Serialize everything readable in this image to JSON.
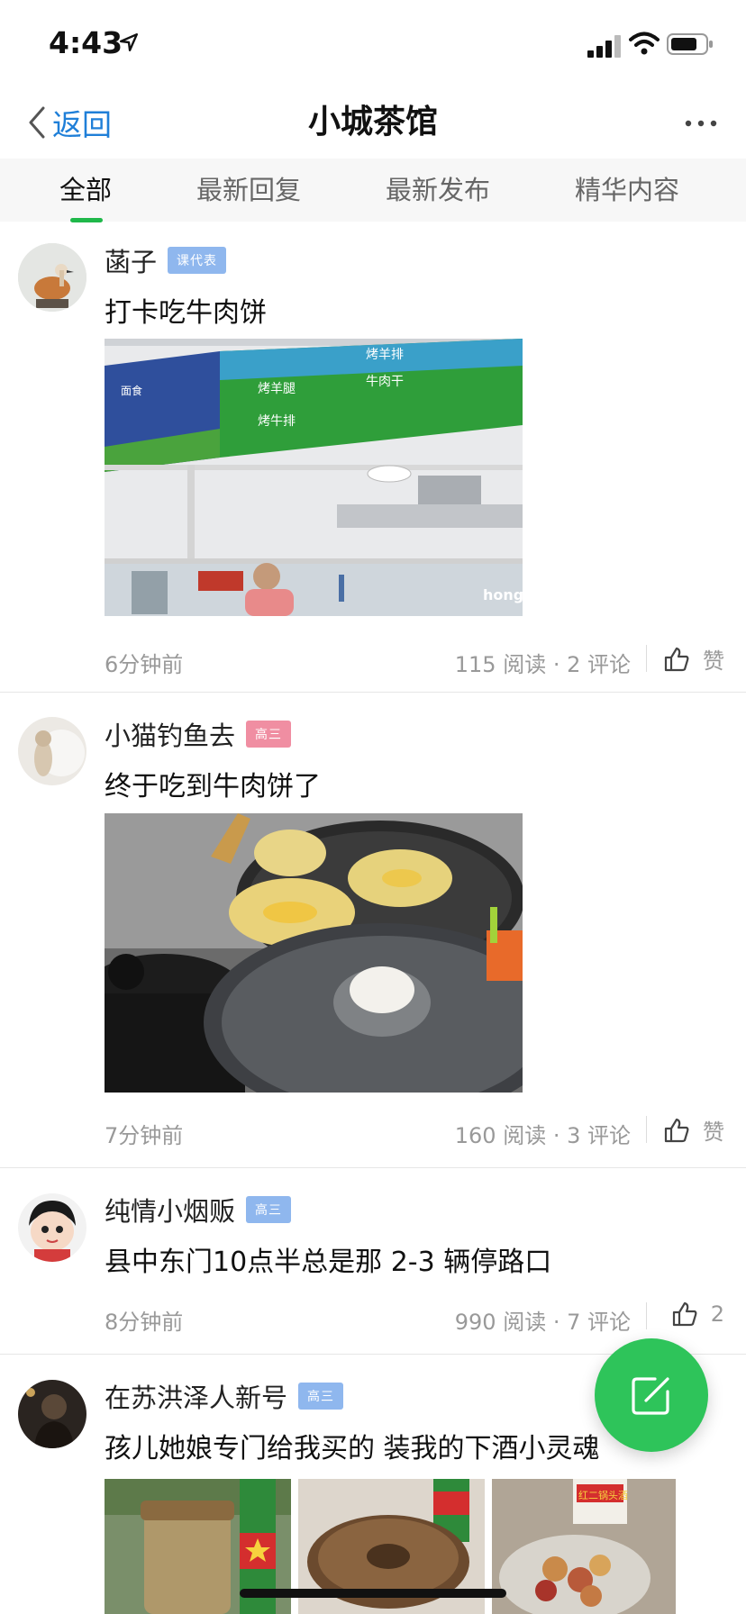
{
  "status_bar": {
    "time": "4:43"
  },
  "nav": {
    "back_label": "返回",
    "title": "小城茶馆"
  },
  "tabs": [
    {
      "label": "全部"
    },
    {
      "label": "最新回复"
    },
    {
      "label": "最新发布"
    },
    {
      "label": "精华内容"
    }
  ],
  "posts": [
    {
      "author": "菡子",
      "badge": "课代表",
      "text": "打卡吃牛肉饼",
      "time": "6分钟前",
      "stats": "115 阅读 · 2 评论",
      "like_label": "赞"
    },
    {
      "author": "小猫钓鱼去",
      "badge": "高三",
      "text": "终于吃到牛肉饼了",
      "time": "7分钟前",
      "stats": "160 阅读 · 3 评论",
      "like_label": "赞"
    },
    {
      "author": "纯情小烟贩",
      "badge": "高三",
      "text": "县中东门10点半总是那 2-3 辆停路口",
      "time": "8分钟前",
      "stats": "990 阅读 · 7 评论",
      "like_label": "2"
    },
    {
      "author": "在苏洪泽人新号",
      "badge": "高三",
      "text": "孩儿她娘专门给我买的 装我的下酒小灵魂"
    }
  ],
  "post1_image": {
    "sign_text_1": "烤羊排",
    "sign_text_2": "牛肉干",
    "sign_text_3": "烤羊腿",
    "sign_text_4": "烤牛排",
    "left_sign": "面食",
    "watermark": "hong"
  },
  "post4_images": {
    "label_1": "红二锅头酒",
    "label_2": "红二锅头酒"
  },
  "colors": {
    "accent_green": "#1fb84a",
    "link_blue": "#1f7fd8",
    "fab_green": "#2ec45a"
  },
  "icons": [
    "location-arrow-icon",
    "signal-icon",
    "wifi-icon",
    "battery-icon",
    "chevron-left-icon",
    "more-icon",
    "thumbs-up-icon",
    "edit-icon"
  ]
}
